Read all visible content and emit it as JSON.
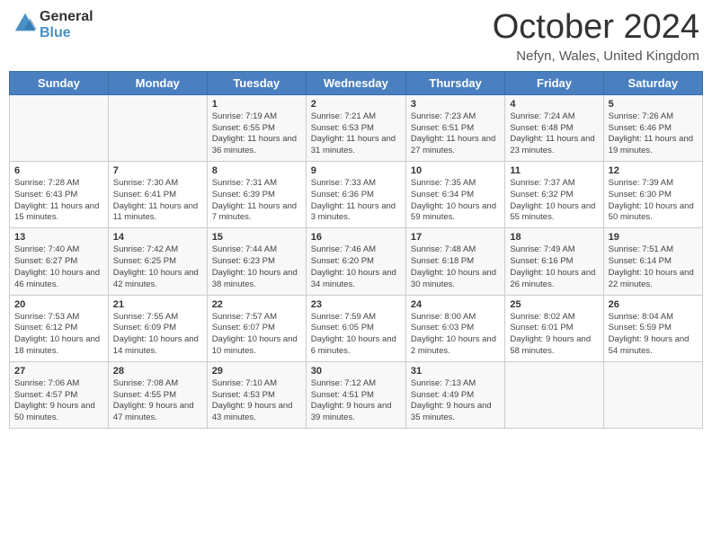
{
  "header": {
    "logo_general": "General",
    "logo_blue": "Blue",
    "month_title": "October 2024",
    "location": "Nefyn, Wales, United Kingdom"
  },
  "days_of_week": [
    "Sunday",
    "Monday",
    "Tuesday",
    "Wednesday",
    "Thursday",
    "Friday",
    "Saturday"
  ],
  "weeks": [
    [
      {
        "day": "",
        "info": ""
      },
      {
        "day": "",
        "info": ""
      },
      {
        "day": "1",
        "info": "Sunrise: 7:19 AM\nSunset: 6:55 PM\nDaylight: 11 hours and 36 minutes."
      },
      {
        "day": "2",
        "info": "Sunrise: 7:21 AM\nSunset: 6:53 PM\nDaylight: 11 hours and 31 minutes."
      },
      {
        "day": "3",
        "info": "Sunrise: 7:23 AM\nSunset: 6:51 PM\nDaylight: 11 hours and 27 minutes."
      },
      {
        "day": "4",
        "info": "Sunrise: 7:24 AM\nSunset: 6:48 PM\nDaylight: 11 hours and 23 minutes."
      },
      {
        "day": "5",
        "info": "Sunrise: 7:26 AM\nSunset: 6:46 PM\nDaylight: 11 hours and 19 minutes."
      }
    ],
    [
      {
        "day": "6",
        "info": "Sunrise: 7:28 AM\nSunset: 6:43 PM\nDaylight: 11 hours and 15 minutes."
      },
      {
        "day": "7",
        "info": "Sunrise: 7:30 AM\nSunset: 6:41 PM\nDaylight: 11 hours and 11 minutes."
      },
      {
        "day": "8",
        "info": "Sunrise: 7:31 AM\nSunset: 6:39 PM\nDaylight: 11 hours and 7 minutes."
      },
      {
        "day": "9",
        "info": "Sunrise: 7:33 AM\nSunset: 6:36 PM\nDaylight: 11 hours and 3 minutes."
      },
      {
        "day": "10",
        "info": "Sunrise: 7:35 AM\nSunset: 6:34 PM\nDaylight: 10 hours and 59 minutes."
      },
      {
        "day": "11",
        "info": "Sunrise: 7:37 AM\nSunset: 6:32 PM\nDaylight: 10 hours and 55 minutes."
      },
      {
        "day": "12",
        "info": "Sunrise: 7:39 AM\nSunset: 6:30 PM\nDaylight: 10 hours and 50 minutes."
      }
    ],
    [
      {
        "day": "13",
        "info": "Sunrise: 7:40 AM\nSunset: 6:27 PM\nDaylight: 10 hours and 46 minutes."
      },
      {
        "day": "14",
        "info": "Sunrise: 7:42 AM\nSunset: 6:25 PM\nDaylight: 10 hours and 42 minutes."
      },
      {
        "day": "15",
        "info": "Sunrise: 7:44 AM\nSunset: 6:23 PM\nDaylight: 10 hours and 38 minutes."
      },
      {
        "day": "16",
        "info": "Sunrise: 7:46 AM\nSunset: 6:20 PM\nDaylight: 10 hours and 34 minutes."
      },
      {
        "day": "17",
        "info": "Sunrise: 7:48 AM\nSunset: 6:18 PM\nDaylight: 10 hours and 30 minutes."
      },
      {
        "day": "18",
        "info": "Sunrise: 7:49 AM\nSunset: 6:16 PM\nDaylight: 10 hours and 26 minutes."
      },
      {
        "day": "19",
        "info": "Sunrise: 7:51 AM\nSunset: 6:14 PM\nDaylight: 10 hours and 22 minutes."
      }
    ],
    [
      {
        "day": "20",
        "info": "Sunrise: 7:53 AM\nSunset: 6:12 PM\nDaylight: 10 hours and 18 minutes."
      },
      {
        "day": "21",
        "info": "Sunrise: 7:55 AM\nSunset: 6:09 PM\nDaylight: 10 hours and 14 minutes."
      },
      {
        "day": "22",
        "info": "Sunrise: 7:57 AM\nSunset: 6:07 PM\nDaylight: 10 hours and 10 minutes."
      },
      {
        "day": "23",
        "info": "Sunrise: 7:59 AM\nSunset: 6:05 PM\nDaylight: 10 hours and 6 minutes."
      },
      {
        "day": "24",
        "info": "Sunrise: 8:00 AM\nSunset: 6:03 PM\nDaylight: 10 hours and 2 minutes."
      },
      {
        "day": "25",
        "info": "Sunrise: 8:02 AM\nSunset: 6:01 PM\nDaylight: 9 hours and 58 minutes."
      },
      {
        "day": "26",
        "info": "Sunrise: 8:04 AM\nSunset: 5:59 PM\nDaylight: 9 hours and 54 minutes."
      }
    ],
    [
      {
        "day": "27",
        "info": "Sunrise: 7:06 AM\nSunset: 4:57 PM\nDaylight: 9 hours and 50 minutes."
      },
      {
        "day": "28",
        "info": "Sunrise: 7:08 AM\nSunset: 4:55 PM\nDaylight: 9 hours and 47 minutes."
      },
      {
        "day": "29",
        "info": "Sunrise: 7:10 AM\nSunset: 4:53 PM\nDaylight: 9 hours and 43 minutes."
      },
      {
        "day": "30",
        "info": "Sunrise: 7:12 AM\nSunset: 4:51 PM\nDaylight: 9 hours and 39 minutes."
      },
      {
        "day": "31",
        "info": "Sunrise: 7:13 AM\nSunset: 4:49 PM\nDaylight: 9 hours and 35 minutes."
      },
      {
        "day": "",
        "info": ""
      },
      {
        "day": "",
        "info": ""
      }
    ]
  ]
}
